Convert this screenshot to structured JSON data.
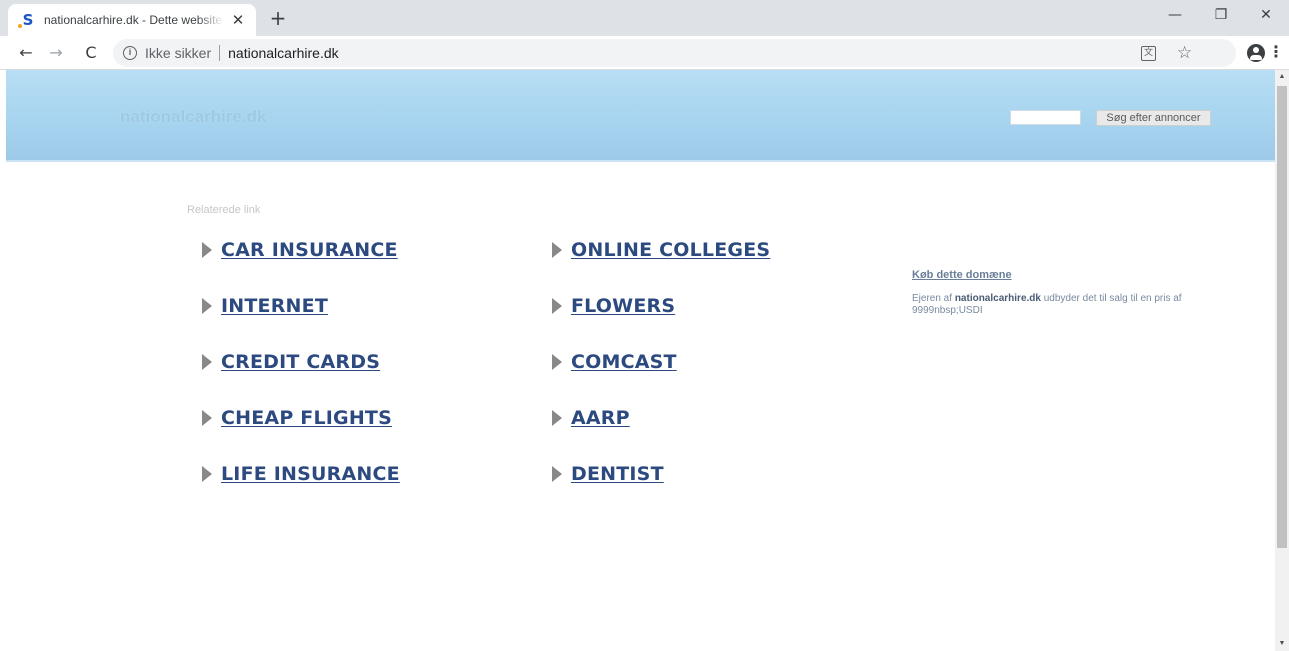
{
  "browser": {
    "tab": {
      "favicon": "S",
      "title": "nationalcarhire.dk - Dette website er til salg",
      "close_glyph": "✕"
    },
    "new_tab_glyph": "+",
    "window_controls": {
      "minimize": "—",
      "maximize": "❐",
      "close": "✕"
    },
    "nav": {
      "back": "←",
      "forward": "→",
      "reload": "C"
    },
    "omnibox": {
      "info_glyph": "i",
      "security_label": "Ikke sikker",
      "url": "nationalcarhire.dk"
    },
    "icons": {
      "translate": "translate-icon",
      "bookmark": "star-icon",
      "account": "account-icon",
      "menu": "menu-icon"
    },
    "star_glyph": "☆",
    "menu_glyph": "⋮",
    "translate_glyph": "文"
  },
  "page": {
    "logo": "nationalcarhire.dk",
    "search": {
      "value": "",
      "button_label": "Søg efter annoncer"
    },
    "related_heading": "Relaterede link",
    "links_left": [
      "CAR INSURANCE",
      "INTERNET",
      "CREDIT CARDS",
      "CHEAP FLIGHTS",
      "LIFE INSURANCE"
    ],
    "links_right": [
      "ONLINE COLLEGES",
      "FLOWERS",
      "COMCAST",
      "AARP",
      "DENTIST"
    ],
    "sale": {
      "title": "Køb dette domæne",
      "desc_prefix": "Ejeren af ",
      "desc_domain": "nationalcarhire.dk",
      "desc_suffix": " udbyder det til salg til en pris af 9999nbsp;USDI"
    }
  },
  "colors": {
    "banner": "#a6d3ef",
    "link": "#2c4a80",
    "arrow": "#888888"
  }
}
